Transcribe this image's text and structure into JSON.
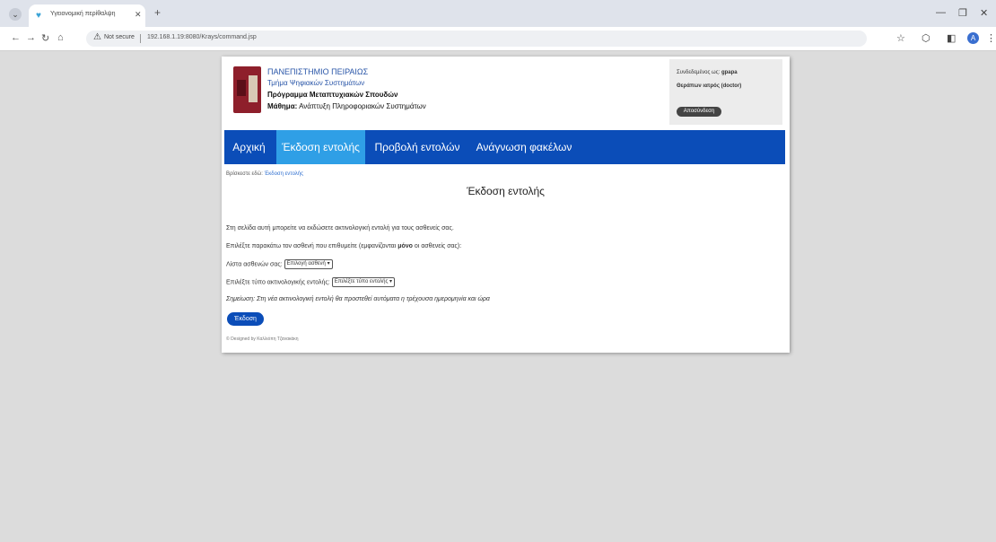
{
  "browser": {
    "tab_title": "Υγειονομική περίθαλψη",
    "not_secure": "Not secure",
    "url": "192.168.1.19:8080/Krays/command.jsp",
    "profile_initial": "A"
  },
  "header": {
    "university": "ΠΑΝΕΠΙΣΤΗΜΙΟ ΠΕΙΡΑΙΩΣ",
    "department": "Τμήμα Ψηφιακών Συστημάτων",
    "program": "Πρόγραμμα Μεταπτυχιακών Σπουδών",
    "course_label": "Μάθημα:",
    "course_name": "Ανάπτυξη Πληροφοριακών Συστημάτων"
  },
  "user_box": {
    "connected_label": "Συνδεδεμένος ως:",
    "username": "gpapa",
    "role_label": "Θεράπων ιατρός",
    "role": "(doctor)",
    "logout_label": "Αποσύνδεση"
  },
  "nav": {
    "items": [
      {
        "label": "Αρχική"
      },
      {
        "label": "Έκδοση εντολής"
      },
      {
        "label": "Προβολή εντολών"
      },
      {
        "label": "Ανάγνωση φακέλων"
      }
    ],
    "active_index": 1
  },
  "breadcrumb": {
    "prefix": "Βρίσκεστε εδώ:",
    "current": "Έκδοση εντολής"
  },
  "main": {
    "title": "Έκδοση εντολής",
    "intro": "Στη σελίδα αυτή μπορείτε να εκδώσετε ακτινολογική εντολή για τους ασθενείς σας.",
    "select_prompt_pre": "Επιλέξτε παρακάτω τον ασθενή που επιθυμείτε (εμφανίζονται",
    "select_prompt_bold": "μόνο",
    "select_prompt_post": "οι ασθενείς σας):",
    "patients_label": "Λίστα ασθενών σας:",
    "patients_selected": "Επιλογή ασθενή",
    "type_label": "Επιλέξτε τύπο ακτινολογικής εντολής:",
    "type_selected": "Επιλέξτε τύπο εντολής",
    "note": "Σημείωση: Στη νέα ακτινολογική εντολή θα προστεθεί αυτόματα η τρέχουσα ημερομηνία και ώρα",
    "submit_label": "Έκδοση"
  },
  "footer": {
    "text": "© Designed by Καλλιόπη Τζανακάκη"
  }
}
